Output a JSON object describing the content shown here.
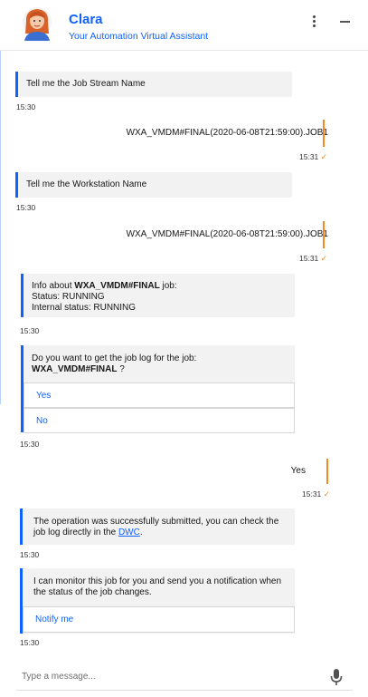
{
  "header": {
    "name": "Clara",
    "subtitle": "Your Automation Virtual Assistant"
  },
  "messages": [
    {
      "from": "bot",
      "text": "Tell me the Job Stream Name",
      "time": "15:30"
    },
    {
      "from": "user",
      "text": "WXA_VMDM#FINAL(2020-06-08T21:59:00).JOB1",
      "time": "15:31"
    },
    {
      "from": "bot",
      "text": "Tell me the Workstation Name",
      "time": "15:30"
    },
    {
      "from": "user",
      "text": "WXA_VMDM#FINAL(2020-06-08T21:59:00).JOB1",
      "time": "15:31"
    },
    {
      "from": "bot",
      "lines": {
        "intro": "Info about ",
        "job": "WXA_VMDM#FINAL",
        "intro_end": " job:",
        "status": "Status: RUNNING",
        "internal": "Internal status: RUNNING"
      },
      "time": "15:30"
    },
    {
      "from": "bot",
      "lines": {
        "q1": "Do you want to get the job log for the job:",
        "job": "WXA_VMDM#FINAL",
        "q_end": " ?"
      },
      "options": [
        "Yes",
        "No"
      ],
      "time": "15:30"
    },
    {
      "from": "user",
      "text": "Yes",
      "time": "15:31"
    },
    {
      "from": "bot",
      "lines": {
        "l1": "The operation was successfully submitted, you can check the",
        "l2": "job log directly in the ",
        "link": "DWC",
        "l2_end": "."
      },
      "time": "15:30"
    },
    {
      "from": "bot",
      "lines": {
        "l1": "I can monitor this job for you and send you a notification when",
        "l2": "the status of the job changes."
      },
      "options": [
        "Notify me"
      ],
      "time": "15:30"
    }
  ],
  "read_mark": "✓",
  "composer": {
    "placeholder": "Type a message..."
  },
  "colors": {
    "accent": "#0f62fe",
    "user_bar": "#f08a24",
    "bot_bubble": "#f2f2f2"
  },
  "icons": [
    "avatar",
    "kebab-menu-icon",
    "minimize-icon",
    "microphone-icon"
  ]
}
